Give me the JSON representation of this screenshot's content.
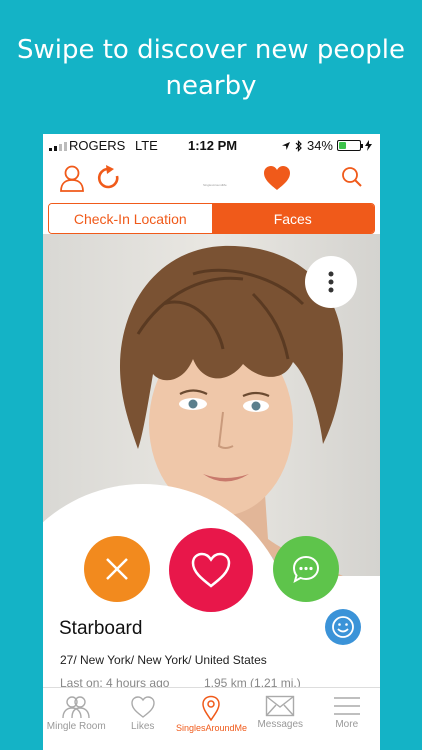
{
  "promo": {
    "line1": "Swipe to discover new people",
    "line2": "nearby"
  },
  "status_bar": {
    "carrier": "ROGERS",
    "network": "LTE",
    "time": "1:12 PM",
    "battery": "34%",
    "battery_level": 0.34
  },
  "nav": {
    "logo_text": "SinglesAroundMe",
    "icons": [
      "profile-icon",
      "refresh-icon",
      "heart-icon",
      "search-icon"
    ]
  },
  "segmented": {
    "options": [
      "Check-In Location",
      "Faces"
    ],
    "selected": "Faces"
  },
  "profile": {
    "name": "Starboard",
    "details": "27/ New York/ New York/ United States",
    "last_on": "Last on: 4 hours ago",
    "distance": "1.95 km (1.21 mi.)"
  },
  "tabs": [
    {
      "label": "Mingle Room",
      "icon": "people-icon"
    },
    {
      "label": "Likes",
      "icon": "heart-outline-icon"
    },
    {
      "label": "SinglesAroundMe",
      "icon": "location-pin-icon"
    },
    {
      "label": "Messages",
      "icon": "envelope-icon"
    },
    {
      "label": "More",
      "icon": "menu-icon"
    }
  ],
  "colors": {
    "background": "#14b3c6",
    "accent": "#f05a1a",
    "reject": "#f28a1e",
    "like": "#e8174a",
    "chat": "#5ec44b",
    "smile": "#3b93d8"
  }
}
